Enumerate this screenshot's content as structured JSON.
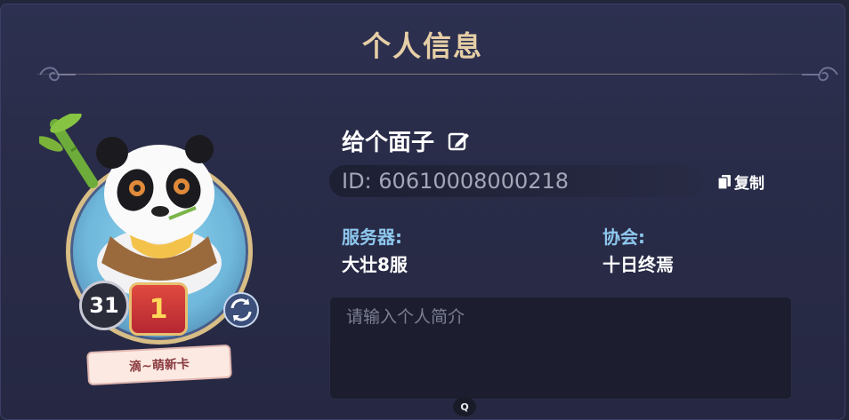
{
  "header": {
    "title": "个人信息"
  },
  "avatar": {
    "level": "31",
    "rank": "1",
    "tag_label": "滴~萌新卡"
  },
  "profile": {
    "name": "给个面子",
    "id_text": "ID: 60610008000218",
    "copy_label": "复制",
    "server_label": "服务器:",
    "server_value": "大壮8服",
    "guild_label": "协会:",
    "guild_value": "十日终焉"
  },
  "intro": {
    "placeholder": "请输入个人简介",
    "value": ""
  },
  "bottom_button": {
    "label": "Q"
  },
  "colors": {
    "title": "#e6cfa6",
    "label_blue": "#8ec7ee",
    "panel_bg": "#2b2e4b",
    "input_bg": "#1c1e30"
  },
  "icons": [
    "edit-icon",
    "copy-icon",
    "refresh-icon",
    "bamboo-icon",
    "panda-avatar-icon"
  ]
}
